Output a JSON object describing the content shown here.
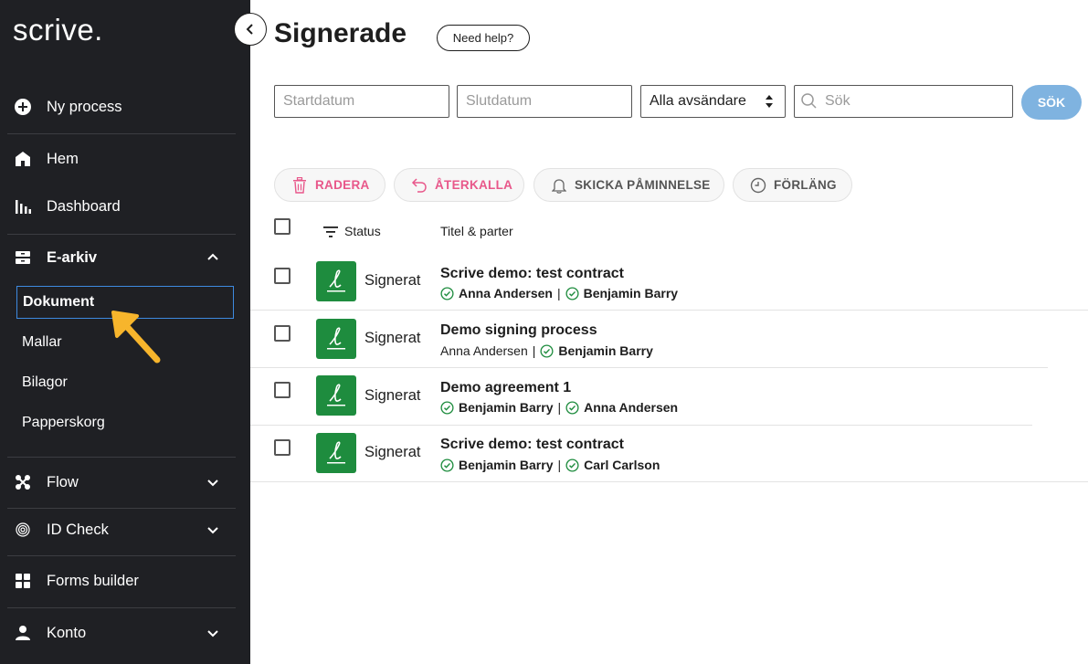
{
  "brand": {
    "logo_text": "scrive."
  },
  "sidebar": {
    "items": [
      {
        "label": "Ny process",
        "icon": "plus-circle-icon"
      },
      {
        "label": "Hem",
        "icon": "home-icon"
      },
      {
        "label": "Dashboard",
        "icon": "bar-chart-icon"
      },
      {
        "label": "E-arkiv",
        "icon": "archive-icon",
        "expanded": true
      },
      {
        "label": "Flow",
        "icon": "flow-icon"
      },
      {
        "label": "ID Check",
        "icon": "fingerprint-icon"
      },
      {
        "label": "Forms builder",
        "icon": "grid-icon"
      },
      {
        "label": "Konto",
        "icon": "user-icon"
      }
    ],
    "sub_items": [
      {
        "label": "Dokument",
        "active": true
      },
      {
        "label": "Mallar"
      },
      {
        "label": "Bilagor"
      },
      {
        "label": "Papperskorg"
      }
    ]
  },
  "header": {
    "title": "Signerade",
    "help_label": "Need help?"
  },
  "filters": {
    "start_placeholder": "Startdatum",
    "end_placeholder": "Slutdatum",
    "sender_value": "Alla avsändare",
    "search_placeholder": "Sök",
    "search_button": "SÖK"
  },
  "actions": {
    "delete": "RADERA",
    "recall": "ÅTERKALLA",
    "remind": "SKICKA PÅMINNELSE",
    "extend": "FÖRLÄNG"
  },
  "table": {
    "col_status": "Status",
    "col_title": "Titel & parter",
    "rows": [
      {
        "status": "Signerat",
        "title": "Scrive demo: test contract",
        "party1": "Anna Andersen",
        "party1_signed": true,
        "party2": "Benjamin Barry",
        "party2_signed": true
      },
      {
        "status": "Signerat",
        "title": "Demo signing process",
        "party1": "Anna Andersen",
        "party1_signed": false,
        "party2": "Benjamin Barry",
        "party2_signed": true
      },
      {
        "status": "Signerat",
        "title": "Demo agreement 1",
        "party1": "Benjamin Barry",
        "party1_signed": true,
        "party2": "Anna Andersen",
        "party2_signed": true
      },
      {
        "status": "Signerat",
        "title": "Scrive demo: test contract",
        "party1": "Benjamin Barry",
        "party1_signed": true,
        "party2": "Carl Carlson",
        "party2_signed": true
      }
    ]
  },
  "separator": "|",
  "colors": {
    "sidebar_bg": "#1f2024",
    "accent_blue": "#3d8ae0",
    "status_green": "#1e8c3e",
    "action_pink": "#e8578a",
    "search_button": "#7fb3e0",
    "arrow_yellow": "#f7b52c"
  }
}
